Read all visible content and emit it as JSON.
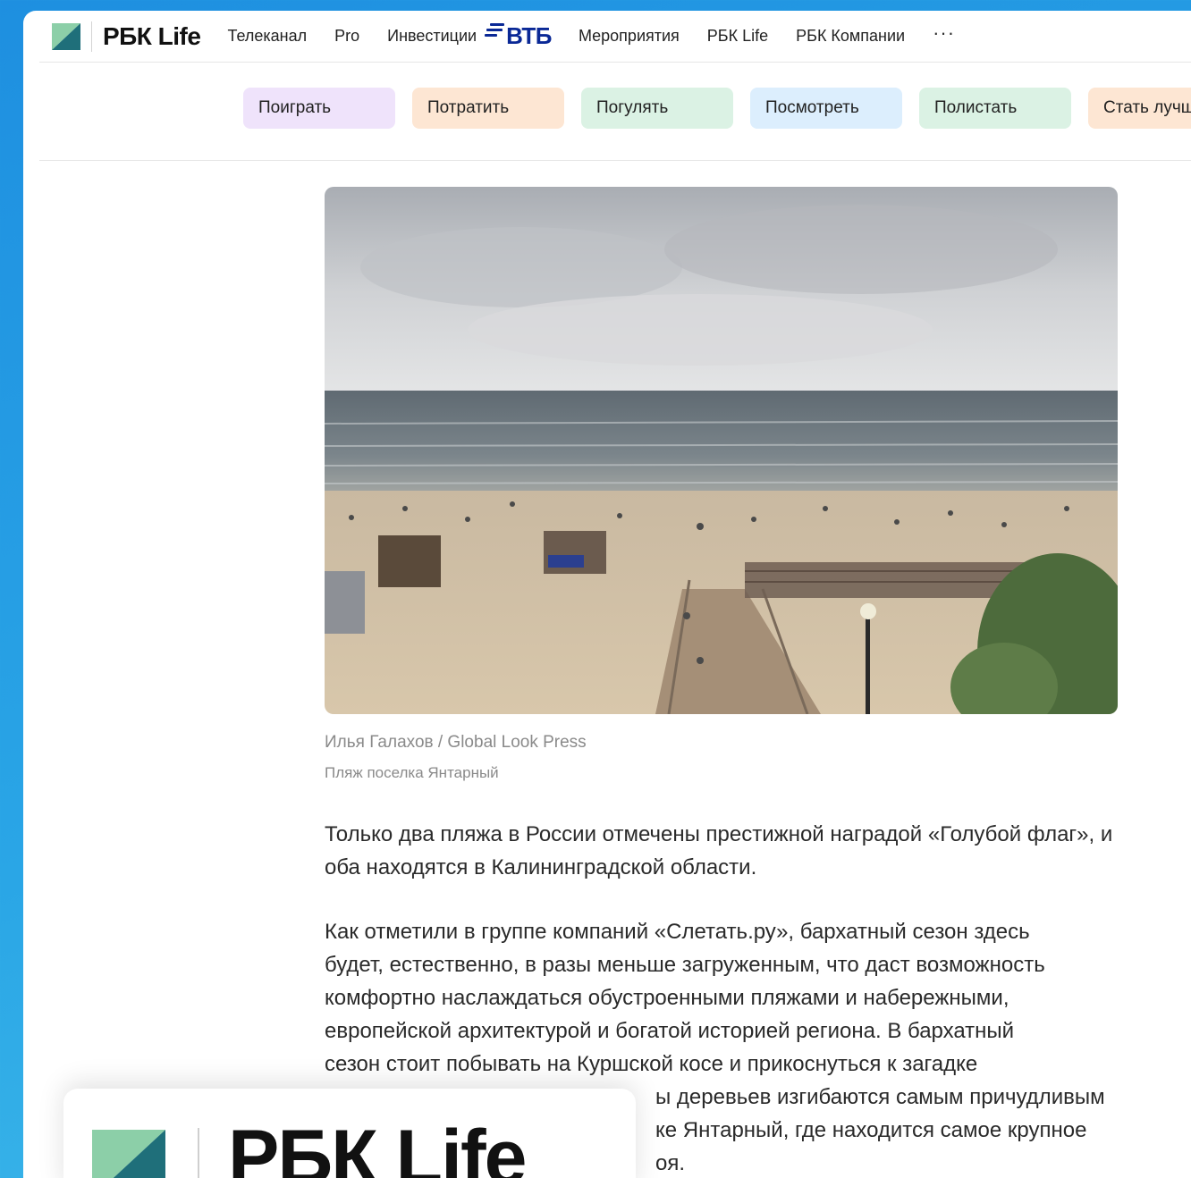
{
  "header": {
    "logo_text": "РБК Life",
    "nav": [
      "Телеканал",
      "Pro",
      "Инвестиции"
    ],
    "sponsor": "ВТБ",
    "nav_after": [
      "Мероприятия",
      "РБК Life",
      "РБК Компании"
    ],
    "more": "···"
  },
  "chips": [
    {
      "label": "Поиграть",
      "color": "#efe3fb"
    },
    {
      "label": "Потратить",
      "color": "#fde6d3"
    },
    {
      "label": "Погулять",
      "color": "#dbf2e4"
    },
    {
      "label": "Посмотреть",
      "color": "#dceefd"
    },
    {
      "label": "Полистать",
      "color": "#dbf2e4"
    },
    {
      "label": "Стать лучше",
      "color": "#fde6d3"
    }
  ],
  "photo": {
    "credit": "Илья Галахов / Global Look Press",
    "caption": "Пляж поселка Янтарный"
  },
  "article": {
    "p1": "Только два пляжа в России отмечены престижной наградой «Голубой флаг», и оба находятся в Калининградской области.",
    "p2_lines": [
      "Как отметили в группе компаний «Слетать.ру», бархатный сезон здесь",
      "будет, естественно, в разы меньше загруженным, что даст возможность",
      "комфортно наслаждаться обустроенными пляжами и набережными,",
      "европейской архитектурой и богатой историей региона. В бархатный",
      "сезон стоит побывать на Куршской косе и прикоснуться к загадке",
      "ы деревьев изгибаются самым причудливым",
      "ке Янтарный, где находится самое крупное",
      "оя."
    ]
  },
  "overlay": {
    "logo_text": "РБК Life"
  },
  "colors": {
    "logo_green": "#8ccfa8",
    "logo_teal": "#1f6f7a",
    "vtb_blue": "#0a2896"
  }
}
